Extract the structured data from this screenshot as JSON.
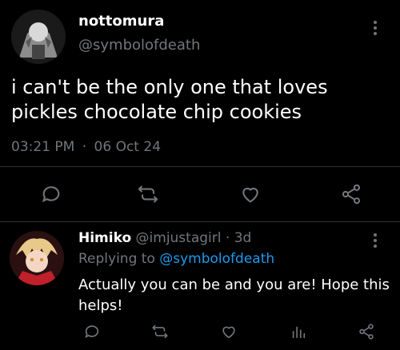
{
  "tweet": {
    "display_name": "nottomura",
    "handle": "@symbolofdeath",
    "text": "i can't be the only one that loves pickles chocolate chip cookies",
    "time": "03:21 PM",
    "separator": "·",
    "date": "06 Oct 24"
  },
  "reply": {
    "display_name": "Himiko",
    "handle": "@imjustagirl",
    "separator": "·",
    "age": "3d",
    "replying_prefix": "Replying to",
    "replying_to": "@symbolofdeath",
    "text": "Actually you can be and you are! Hope this helps!"
  },
  "icons": {
    "reply": "comment-icon",
    "retweet": "retweet-icon",
    "like": "heart-icon",
    "stats": "bar-chart-icon",
    "share": "share-icon",
    "more": "more-vertical-icon"
  },
  "colors": {
    "background": "#000000",
    "text": "#ffffff",
    "secondary": "#71767b",
    "accent": "#1d9bf0",
    "divider": "#2f3336"
  }
}
